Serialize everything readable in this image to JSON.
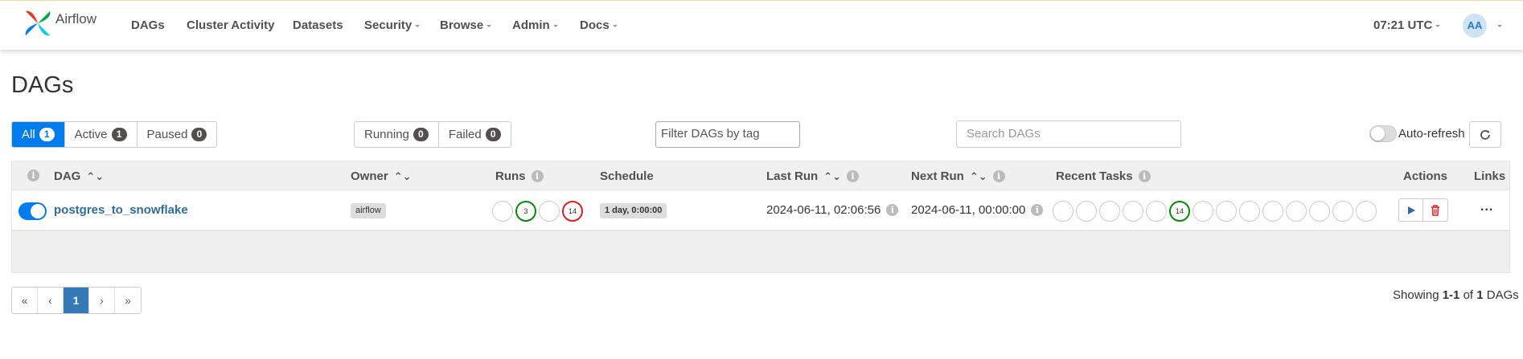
{
  "navbar": {
    "brand": "Airflow",
    "items": [
      {
        "label": "DAGs",
        "dropdown": false
      },
      {
        "label": "Cluster Activity",
        "dropdown": false
      },
      {
        "label": "Datasets",
        "dropdown": false
      },
      {
        "label": "Security",
        "dropdown": true
      },
      {
        "label": "Browse",
        "dropdown": true
      },
      {
        "label": "Admin",
        "dropdown": true
      },
      {
        "label": "Docs",
        "dropdown": true
      }
    ],
    "clock": "07:21 UTC",
    "user_initials": "AA"
  },
  "page_title": "DAGs",
  "status_filters": [
    {
      "label": "All",
      "count": "1",
      "active": true
    },
    {
      "label": "Active",
      "count": "1",
      "active": false
    },
    {
      "label": "Paused",
      "count": "0",
      "active": false
    }
  ],
  "run_filters": [
    {
      "label": "Running",
      "count": "0"
    },
    {
      "label": "Failed",
      "count": "0"
    }
  ],
  "tag_filter": {
    "placeholder": "Filter DAGs by tag"
  },
  "search": {
    "placeholder": "Search DAGs"
  },
  "auto_refresh": {
    "label": "Auto-refresh",
    "enabled": false
  },
  "table": {
    "headers": {
      "dag": "DAG",
      "owner": "Owner",
      "runs": "Runs",
      "schedule": "Schedule",
      "last_run": "Last Run",
      "next_run": "Next Run",
      "recent_tasks": "Recent Tasks",
      "actions": "Actions",
      "links": "Links"
    },
    "rows": [
      {
        "dag_id": "postgres_to_snowflake",
        "paused": false,
        "owner": "airflow",
        "runs": [
          {
            "state": "queued",
            "count": ""
          },
          {
            "state": "success",
            "count": "3"
          },
          {
            "state": "running",
            "count": ""
          },
          {
            "state": "failed",
            "count": "14"
          }
        ],
        "schedule": "1 day, 0:00:00",
        "last_run": "2024-06-11, 02:06:56",
        "next_run": "2024-06-11, 00:00:00",
        "recent_tasks": [
          {
            "state": "none",
            "count": ""
          },
          {
            "state": "none",
            "count": ""
          },
          {
            "state": "none",
            "count": ""
          },
          {
            "state": "none",
            "count": ""
          },
          {
            "state": "none",
            "count": ""
          },
          {
            "state": "success",
            "count": "14"
          },
          {
            "state": "none",
            "count": ""
          },
          {
            "state": "none",
            "count": ""
          },
          {
            "state": "none",
            "count": ""
          },
          {
            "state": "none",
            "count": ""
          },
          {
            "state": "none",
            "count": ""
          },
          {
            "state": "none",
            "count": ""
          },
          {
            "state": "none",
            "count": ""
          },
          {
            "state": "none",
            "count": ""
          }
        ],
        "links_label": "..."
      }
    ]
  },
  "pagination": {
    "first": "«",
    "prev": "‹",
    "current": "1",
    "next": "›",
    "last": "»"
  },
  "footer": {
    "showing_prefix": "Showing",
    "range": "1-1",
    "of": "of",
    "total": "1",
    "suffix": "DAGs"
  },
  "colors": {
    "primary": "#017cee",
    "success": "#078a07",
    "failed": "#e01c1c",
    "dag_link": "#2f6b9f"
  },
  "icons": {
    "trigger": "play-icon",
    "delete": "trash-icon",
    "refresh": "refresh-icon",
    "info": "info-icon",
    "sort": "sort-icon"
  }
}
